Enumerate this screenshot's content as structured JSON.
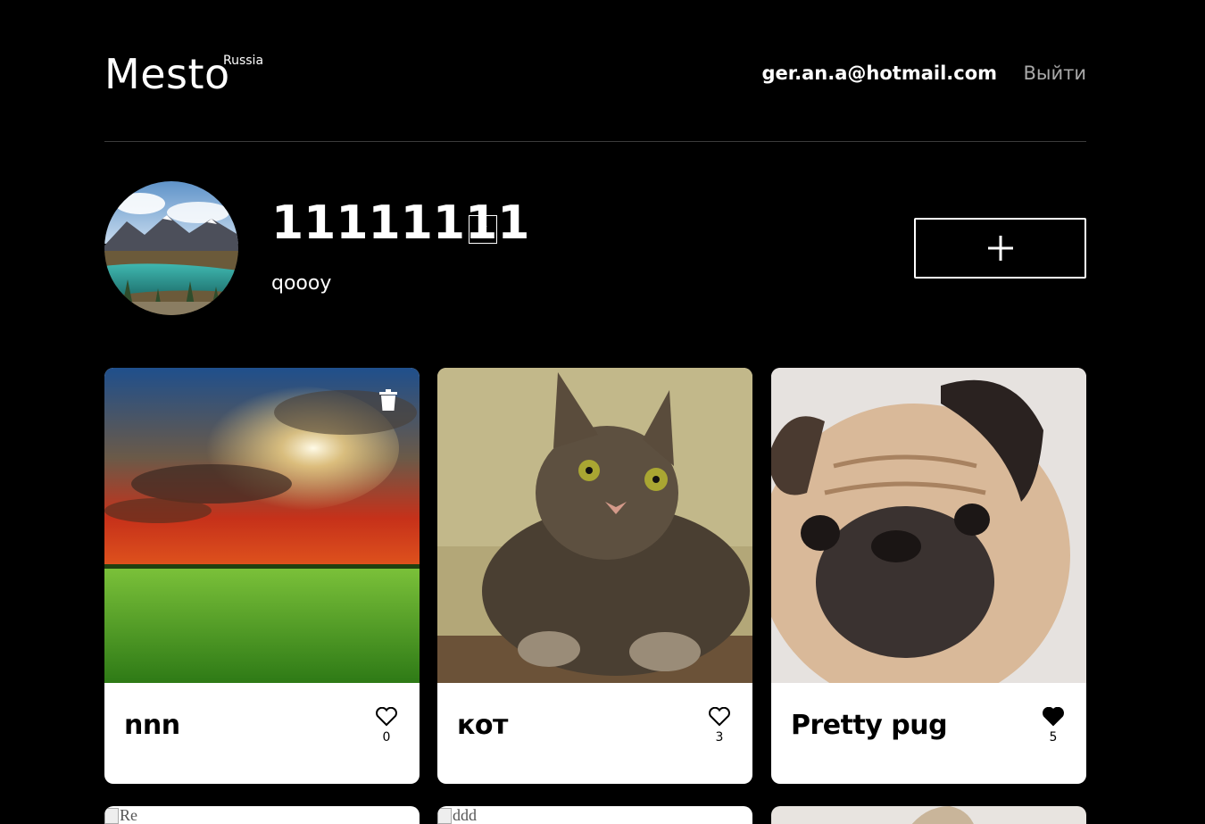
{
  "header": {
    "logo": "Mesto",
    "logo_sub": "Russia",
    "email": "ger.an.a@hotmail.com",
    "logout": "Выйти"
  },
  "profile": {
    "name": "11111111",
    "job": "qoooy"
  },
  "cards": [
    {
      "title": "nnn",
      "likes": "0",
      "liked": false,
      "deletable": true
    },
    {
      "title": "кот",
      "likes": "3",
      "liked": false,
      "deletable": false
    },
    {
      "title": "Pretty pug",
      "likes": "5",
      "liked": true,
      "deletable": false
    }
  ],
  "cards_row2": [
    {
      "alt": "Re"
    },
    {
      "alt": "ddd"
    },
    {
      "alt": ""
    }
  ],
  "colors": {
    "background": "#000000",
    "card": "#ffffff",
    "muted_link": "#a9a9a9"
  }
}
